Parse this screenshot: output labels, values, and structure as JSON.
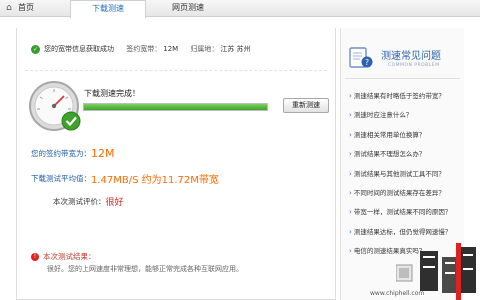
{
  "tabs": {
    "home": "首页",
    "speed_test": "下载测速",
    "web_speed": "网页测速"
  },
  "status": {
    "success_text": "您的宽带信息获取成功",
    "contract_label": "签约宽带：",
    "contract_value": "12M",
    "location_label": "归属地：",
    "location_value": "江苏 苏州"
  },
  "test": {
    "done_text": "下载测速完成！",
    "progress": 1.0,
    "retest_label": "重新测速"
  },
  "results": {
    "contract_label": "您的签约带宽为：",
    "contract_value": "12M",
    "avg_label": "下载测试平均值：",
    "avg_value": "1.47MB/S 约为11.72M带宽",
    "eval_label": "本次测试评价：",
    "eval_value": "很好"
  },
  "conclusion": {
    "title": "本次测试结果：",
    "body": "很好。您的上网速度非常理想，能够正常完成各种互联网应用。"
  },
  "faq": {
    "title": "测速常见问题",
    "subtitle": "COMMON PROBLEM",
    "items": [
      "测速结果有时略低于签约带宽？",
      "测速时应注意什么？",
      "测速相关常用单位换算？",
      "测试结果不理想怎么办？",
      "测试结果与其他测试工具不同？",
      "不同时间的测试结果存在差异？",
      "带宽一样，测试结果不同的原因？",
      "测速结果达标，但仍觉得网速慢？",
      "电信的测速结果真实吗？"
    ]
  },
  "watermark": {
    "text": "www.chiphell.com"
  },
  "colors": {
    "accent_blue": "#1d5ea8",
    "value_orange": "#ff6a00",
    "eval_red": "#e02020",
    "progress_green": "#3ea22b"
  }
}
